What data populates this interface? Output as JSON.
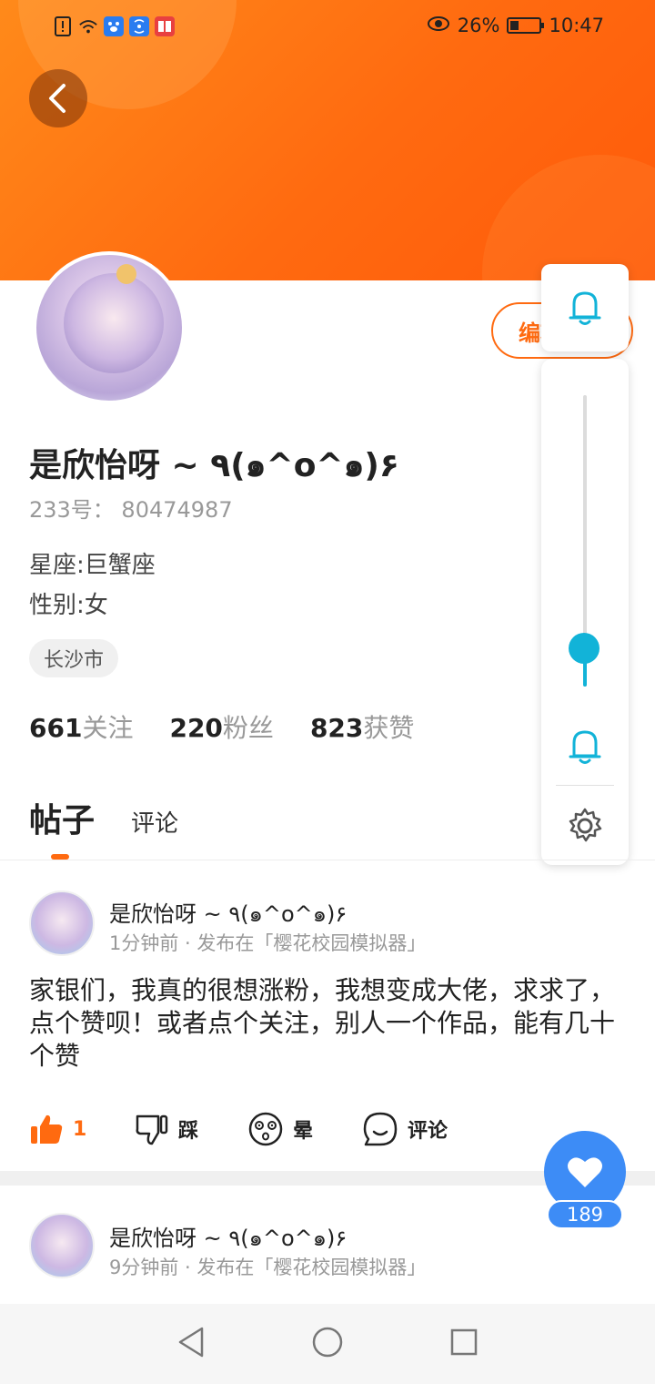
{
  "status_bar": {
    "battery": "26%",
    "time": "10:47",
    "icons": [
      "alert-icon",
      "wifi-icon",
      "baidu-icon",
      "cast-icon",
      "book-icon",
      "eye-icon",
      "battery-icon"
    ]
  },
  "header": {
    "back_icon": "chevron-left-icon",
    "accent_color": "#ff6a10"
  },
  "profile": {
    "name": "是欣怡呀 ~ ٩(๑^o^๑)۶",
    "uid": "233号： 80474987",
    "zodiac": "星座:巨蟹座",
    "gender": "性别:女",
    "city": "长沙市",
    "edit_label": "编辑资料",
    "stats": [
      {
        "num": "661",
        "label": "关注"
      },
      {
        "num": "220",
        "label": "粉丝"
      },
      {
        "num": "823",
        "label": "获赞"
      }
    ]
  },
  "volume_panel": {
    "level": 0.13,
    "accent": "#12b3d8"
  },
  "tabs": [
    {
      "label": "帖子",
      "active": true
    },
    {
      "label": "评论",
      "active": false
    }
  ],
  "posts": [
    {
      "author": "是欣怡呀 ~ ٩(๑^o^๑)۶",
      "meta": "1分钟前 · 发布在「樱花校园模拟器」",
      "content": "家银们，我真的很想涨粉，我想变成大佬，求求了，点个赞呗！或者点个关注，别人一个作品，能有几十个赞",
      "actions": [
        {
          "icon": "thumbs-up-icon",
          "label": "1"
        },
        {
          "icon": "thumbs-down-icon",
          "label": "踩"
        },
        {
          "icon": "dizzy-face-icon",
          "label": "晕"
        },
        {
          "icon": "comment-icon",
          "label": "评论"
        }
      ]
    },
    {
      "author": "是欣怡呀 ~ ٩(๑^o^๑)۶",
      "meta": "9分钟前 · 发布在「樱花校园模拟器」"
    }
  ],
  "like_fab": {
    "count": "189",
    "color": "#3d8cf6"
  },
  "nav_bar": {
    "icons": [
      "back-triangle-icon",
      "home-circle-icon",
      "recents-square-icon"
    ]
  }
}
